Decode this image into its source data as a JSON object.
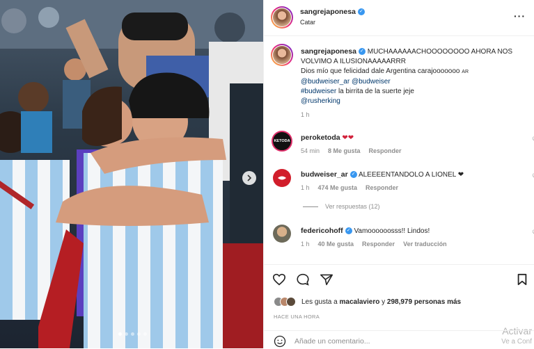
{
  "post": {
    "author": "sangrejaponesa",
    "location": "Catar"
  },
  "caption": {
    "author": "sangrejaponesa",
    "text_line1": "MUCHAAAAAACHOOOOOOOO AHORA NOS VOLVIMO A ILUSIONAAAAARRR",
    "text_line2": "Dios mío que felicidad dale Argentina carajooooooo",
    "text_line2_tag": "AR",
    "mention1": "@budweiser_ar",
    "mention2": "@budweiser",
    "hashtag": "#budweiser",
    "hashtag_text": "la birrita de la suerte jeje",
    "mention3": "@rusherking",
    "time": "1 h"
  },
  "comments": [
    {
      "author": "peroketoda",
      "text": "❤❤",
      "time": "54 min",
      "likes": "8 Me gusta",
      "reply": "Responder"
    },
    {
      "author": "budweiser_ar",
      "text": "ALEEEENTANDOLO A LIONEL ❤",
      "time": "1 h",
      "likes": "474 Me gusta",
      "reply": "Responder"
    },
    {
      "author": "federicohoff",
      "text": "Vamoooooosss!! Lindos!",
      "time": "1 h",
      "likes": "40 Me gusta",
      "reply": "Responder",
      "translate": "Ver traducción"
    }
  ],
  "view_replies": "Ver respuestas (12)",
  "likes_text_prefix": "Les gusta a",
  "likes_user": "macalaviero",
  "likes_text_mid": "y",
  "likes_count": "298,979 personas",
  "likes_suffix": "más",
  "posted_when": "HACE UNA HORA",
  "add_comment_placeholder": "Añade un comentario...",
  "watermark": {
    "line1": "Activar",
    "line2": "Ve a Conf"
  },
  "carousel": {
    "dots": 5,
    "active_index": 0
  }
}
